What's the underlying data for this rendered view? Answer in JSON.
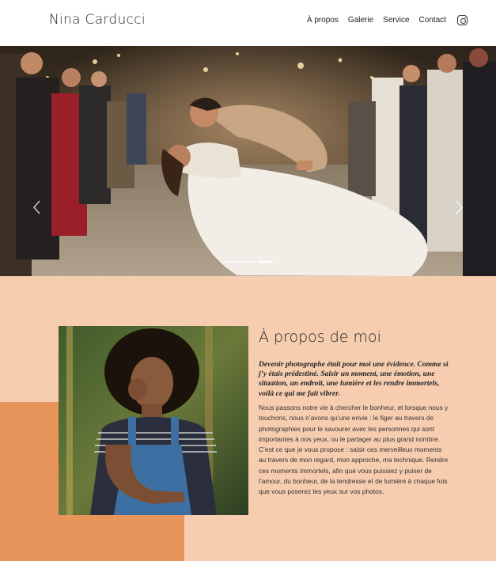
{
  "site": {
    "title": "Nina Carducci"
  },
  "nav": {
    "items": [
      {
        "label": "À propos"
      },
      {
        "label": "Galerie"
      },
      {
        "label": "Service"
      },
      {
        "label": "Contact"
      }
    ],
    "social_icon": "instagram-icon"
  },
  "carousel": {
    "slide_count": 3,
    "active_index": 2,
    "prev_icon": "chevron-left-icon",
    "next_icon": "chevron-right-icon"
  },
  "about": {
    "title": "À propos de moi",
    "lead": "Devenir photographe était pour moi une évidence. Comme si j’y étais prédestiné. Saisir un moment, une émotion, une situation, un endroit, une lumière et les rendre immortels, voilà ce qui me fait vibrer.",
    "body": "Nous passons notre vie à chercher le bonheur, et lorsque nous y touchons, nous n’avons qu’une envie : le figer au travers de photographies pour le savourer avec les personnes qui sont importantes à nos yeux, ou le partager au plus grand nombre. C’est ce que je vous propose : saisir ces merveilleux moments au travers de mon regard, mon approche, ma technique. Rendre ces moments immortels, afin que vous puissiez y puiser de l’amour, du bonheur, de la tendresse et de lumière à chaque fois que vous poserez les yeux sur vos photos."
  },
  "colors": {
    "about_bg": "#f7cdb0",
    "accent_block": "#e8955c",
    "text": "#222222"
  }
}
